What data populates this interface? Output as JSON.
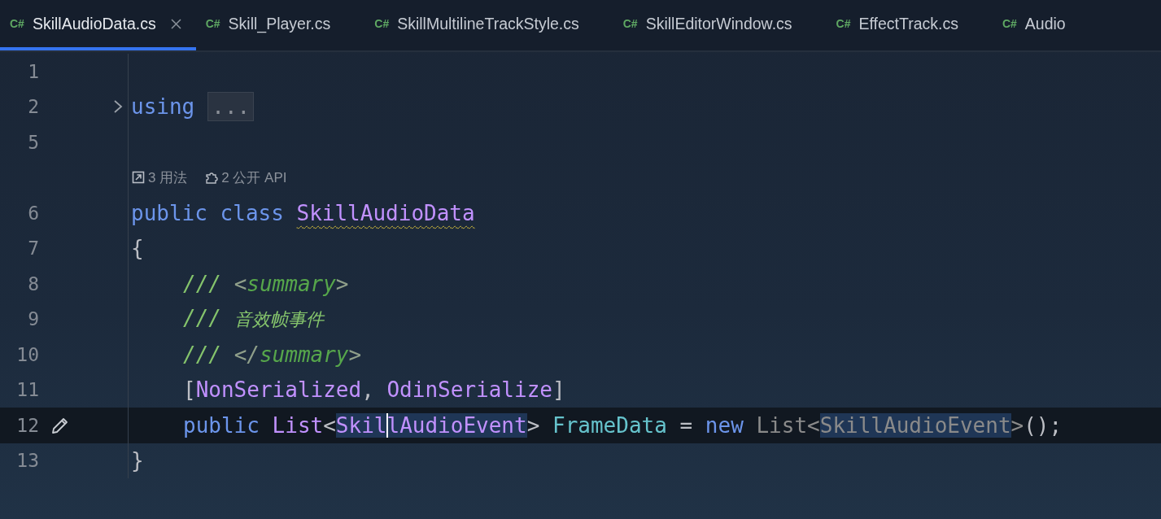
{
  "tabs": [
    {
      "badge": "C#",
      "label": "SkillAudioData.cs",
      "selected": true,
      "closable": true
    },
    {
      "badge": "C#",
      "label": "Skill_Player.cs",
      "selected": false,
      "closable": false
    },
    {
      "badge": "C#",
      "label": "SkillMultilineTrackStyle.cs",
      "selected": false,
      "closable": false
    },
    {
      "badge": "C#",
      "label": "SkillEditorWindow.cs",
      "selected": false,
      "closable": false
    },
    {
      "badge": "C#",
      "label": "EffectTrack.cs",
      "selected": false,
      "closable": false
    },
    {
      "badge": "C#",
      "label": "Audio",
      "selected": false,
      "closable": false
    }
  ],
  "lines": [
    {
      "kind": "code",
      "number": "1",
      "current": false,
      "modified": false
    },
    {
      "kind": "folded",
      "number": "2",
      "current": false,
      "modified": false,
      "indented": false,
      "tokens": [
        {
          "text": "using",
          "kind": "keyword"
        },
        {
          "text": "...",
          "kind": "fold"
        }
      ]
    },
    {
      "kind": "code",
      "number": "5",
      "current": false,
      "modified": false
    },
    {
      "kind": "hints",
      "hints": [
        {
          "kind": "usages",
          "text": "3 用法"
        },
        {
          "kind": "api",
          "text": "2 公开 API"
        }
      ]
    },
    {
      "kind": "code",
      "number": "6",
      "current": false,
      "modified": false,
      "indented": false,
      "tokens": [
        {
          "text": "public class ",
          "kind": "keyword"
        },
        {
          "text": "SkillAudioData",
          "kind": "type",
          "warning": true
        }
      ]
    },
    {
      "kind": "code",
      "number": "7",
      "current": false,
      "modified": false,
      "indented": false,
      "tokens": [
        {
          "text": "{",
          "kind": "plain"
        }
      ]
    },
    {
      "kind": "code",
      "number": "8",
      "current": false,
      "modified": false,
      "indented": true,
      "tokens": [
        {
          "text": "/// ",
          "kind": "comment"
        },
        {
          "text": "<",
          "kind": "doc-bracket"
        },
        {
          "text": "summary",
          "kind": "doc-tag"
        },
        {
          "text": ">",
          "kind": "doc-bracket"
        }
      ]
    },
    {
      "kind": "code",
      "number": "9",
      "current": false,
      "modified": false,
      "indented": true,
      "tokens": [
        {
          "text": "/// ",
          "kind": "comment"
        },
        {
          "text": "音效帧事件",
          "kind": "doc-text"
        }
      ]
    },
    {
      "kind": "code",
      "number": "10",
      "current": false,
      "modified": false,
      "indented": true,
      "tokens": [
        {
          "text": "/// ",
          "kind": "comment"
        },
        {
          "text": "</",
          "kind": "doc-bracket"
        },
        {
          "text": "summary",
          "kind": "doc-tag"
        },
        {
          "text": ">",
          "kind": "doc-bracket"
        }
      ]
    },
    {
      "kind": "code",
      "number": "11",
      "current": false,
      "modified": false,
      "indented": true,
      "tokens": [
        {
          "text": "[",
          "kind": "plain"
        },
        {
          "text": "NonSerialized",
          "kind": "type"
        },
        {
          "text": ", ",
          "kind": "plain"
        },
        {
          "text": "OdinSerialize",
          "kind": "type"
        },
        {
          "text": "]",
          "kind": "plain"
        }
      ]
    },
    {
      "kind": "code",
      "number": "12",
      "current": true,
      "modified": true,
      "indented": true,
      "tokens": [
        {
          "text": "public ",
          "kind": "keyword"
        },
        {
          "text": "List",
          "kind": "type"
        },
        {
          "text": "<",
          "kind": "plain"
        },
        {
          "text": "Skil",
          "kind": "type",
          "highlighted": true
        },
        {
          "text": "lAudioEvent",
          "kind": "type",
          "highlighted": true,
          "caret": true
        },
        {
          "text": "> ",
          "kind": "plain"
        },
        {
          "text": "FrameData",
          "kind": "field"
        },
        {
          "text": " = ",
          "kind": "plain"
        },
        {
          "text": "new ",
          "kind": "keyword"
        },
        {
          "text": "List<",
          "kind": "dim"
        },
        {
          "text": "SkillAudioEvent",
          "kind": "dim",
          "highlighted": true
        },
        {
          "text": ">",
          "kind": "dim"
        },
        {
          "text": "();",
          "kind": "plain"
        }
      ]
    },
    {
      "kind": "code",
      "number": "13",
      "current": false,
      "modified": false,
      "indented": false,
      "tokens": [
        {
          "text": "}",
          "kind": "plain"
        }
      ]
    }
  ]
}
